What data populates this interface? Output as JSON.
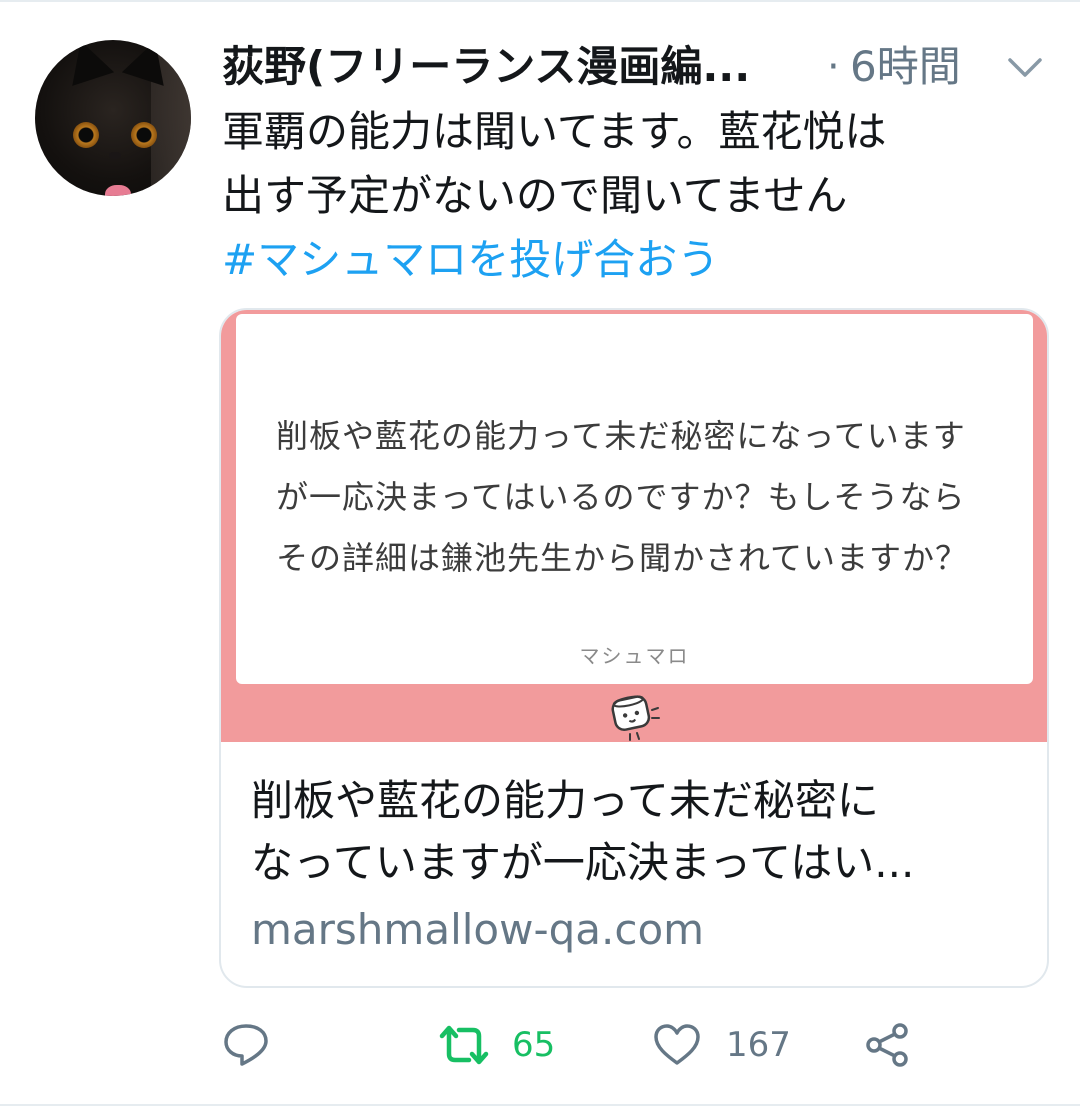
{
  "tweet": {
    "author": {
      "display_name": "荻野(フリーランス漫画編...",
      "avatar_icon": "black-cat-avatar"
    },
    "separator": "·",
    "time": "6時間",
    "menu_icon": "chevron-down-icon",
    "text_lines": [
      "軍覇の能力は聞いてます。藍花悦は",
      "出す予定がないので聞いてません"
    ],
    "hashtag": "#マシュマロを投げ合おう",
    "card": {
      "image": {
        "question_lines": [
          "削板や藍花の能力って未だ秘密になっています",
          "が一応決まってはいるのですか？もしそうなら",
          "その詳細は鎌池先生から聞かされていますか？"
        ],
        "brand": "マシュマロ",
        "mascot_icon": "marshmallow-mascot-icon"
      },
      "title_lines": [
        "削板や藍花の能力って未だ秘密に",
        "なっていますが一応決まってはい..."
      ],
      "domain": "marshmallow-qa.com"
    },
    "actions": {
      "reply": {
        "icon": "reply-icon"
      },
      "retweet": {
        "icon": "retweet-icon",
        "count": "65"
      },
      "like": {
        "icon": "heart-icon",
        "count": "167"
      },
      "share": {
        "icon": "share-icon"
      }
    }
  },
  "colors": {
    "link": "#1da1f2",
    "retweet_active": "#17bf63",
    "muted": "#657786",
    "card_pink": "#f29b9c",
    "border": "#e1e8ed"
  }
}
